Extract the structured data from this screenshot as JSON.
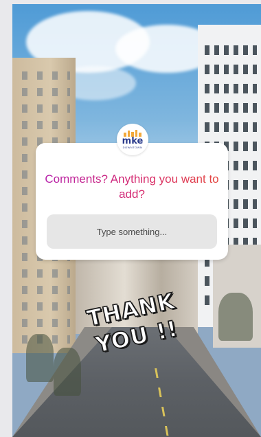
{
  "story": {
    "logo": {
      "name": "mke",
      "subtitle": "DOWNTOWN"
    },
    "question_sticker": {
      "prompt": "Comments? Anything you want to add?",
      "placeholder": "Type something..."
    },
    "thank_you_sticker": {
      "line1": "THANK",
      "line2": "YOU !!"
    }
  },
  "colors": {
    "prompt_gradient_start": "#b31fb0",
    "prompt_gradient_end": "#e64a3a",
    "logo_blue": "#2b3b8c",
    "logo_orange": "#f2a93b",
    "field_bg": "#e6e6e6"
  }
}
